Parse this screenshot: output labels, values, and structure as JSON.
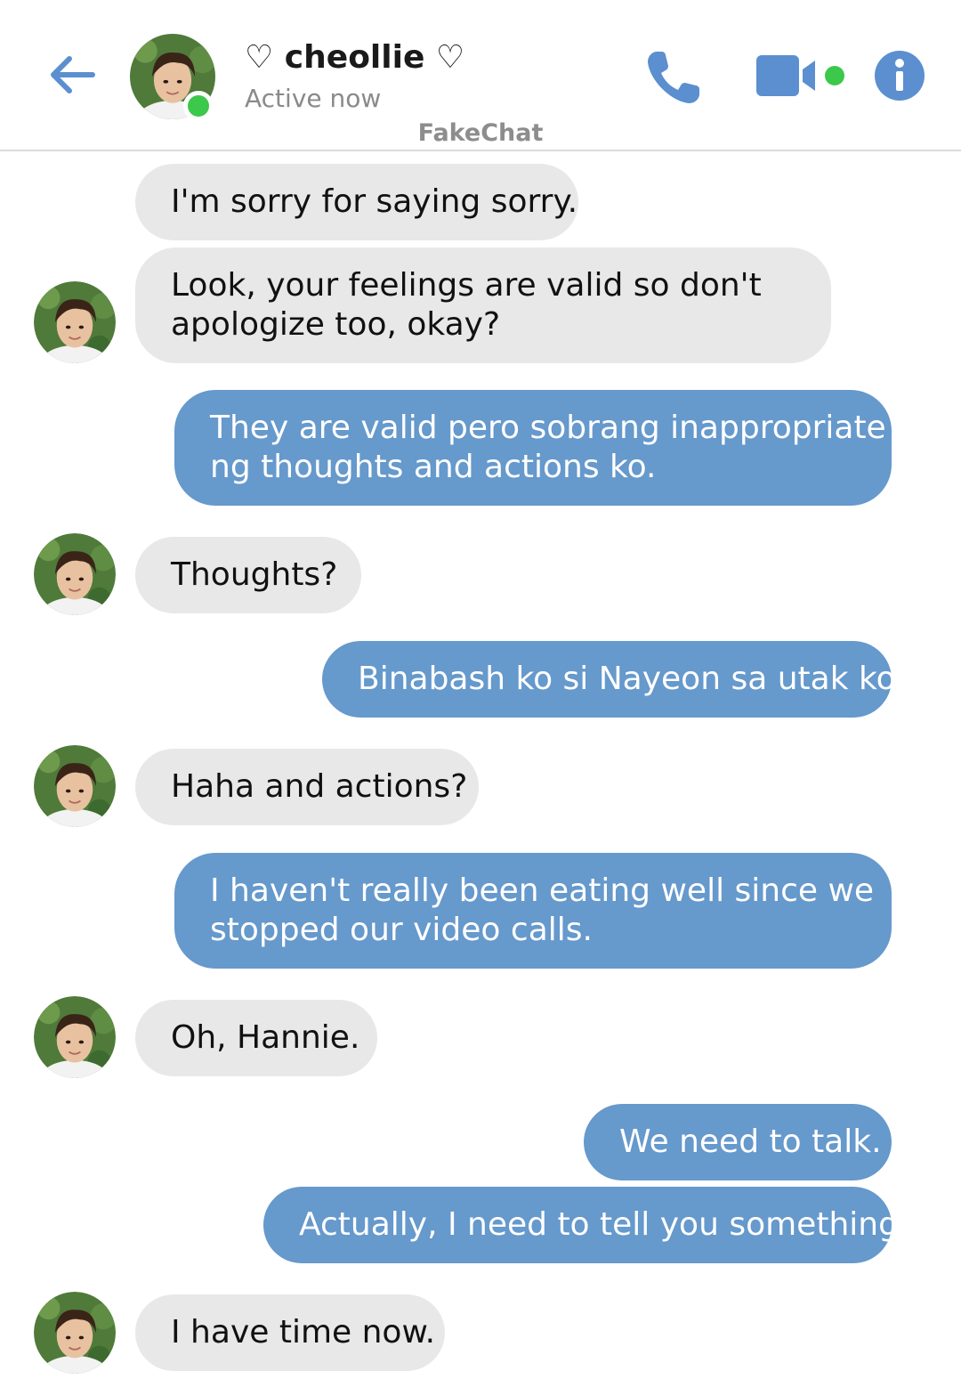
{
  "header": {
    "contact_name": "♡ cheollie ♡",
    "status": "Active now",
    "watermark": "FakeChat",
    "icons": [
      "back-arrow-icon",
      "phone-icon",
      "video-camera-icon",
      "info-icon"
    ]
  },
  "colors": {
    "accent": "#5b8fd0",
    "outgoing_bubble": "#6699cc",
    "incoming_bubble": "#e8e8e8",
    "online": "#3cc84a"
  },
  "messages": [
    {
      "from": "contact",
      "lines": [
        "I'm sorry for saying sorry."
      ]
    },
    {
      "from": "contact",
      "lines": [
        "Look, your feelings are valid so don't",
        "apologize too, okay?"
      ]
    },
    {
      "from": "me",
      "lines": [
        "They are valid pero sobrang inappropriate",
        "ng thoughts and actions ko."
      ]
    },
    {
      "from": "contact",
      "lines": [
        "Thoughts?"
      ]
    },
    {
      "from": "me",
      "lines": [
        "Binabash ko si Nayeon sa utak ko."
      ]
    },
    {
      "from": "contact",
      "lines": [
        "Haha and actions?"
      ]
    },
    {
      "from": "me",
      "lines": [
        "I haven't really been eating well since we",
        "stopped our video calls."
      ]
    },
    {
      "from": "contact",
      "lines": [
        "Oh, Hannie."
      ]
    },
    {
      "from": "me",
      "lines": [
        "We need to talk."
      ]
    },
    {
      "from": "me",
      "lines": [
        "Actually, I need to tell you something."
      ]
    },
    {
      "from": "contact",
      "lines": [
        "I have time now."
      ]
    }
  ]
}
